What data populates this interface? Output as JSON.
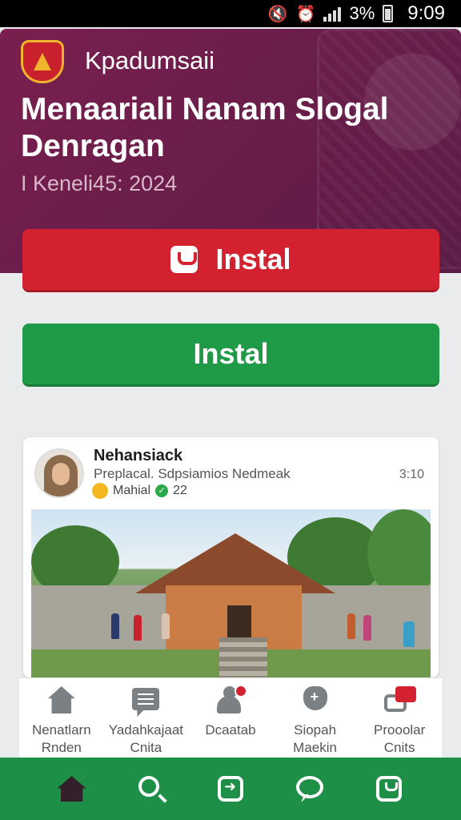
{
  "status_bar": {
    "battery": "3%",
    "time": "9:09"
  },
  "header": {
    "app_name": "Kpadumsaii",
    "title": "Menaariali Nanam Slogal Denragan",
    "date": "I Keneli45: 2024"
  },
  "buttons": {
    "primary_label": "Instal",
    "secondary_label": "Instal"
  },
  "post": {
    "author": "Nehansiack",
    "subtitle": "Preplacal. Sdpsiamios Nedmeak",
    "time": "3:10",
    "meta_label": "Mahial",
    "meta_count": "22"
  },
  "quick_actions": [
    {
      "icon": "home-icon",
      "label": "Nenatlarn Rnden"
    },
    {
      "icon": "chat-icon",
      "label": "Yadahkajaat Cnita"
    },
    {
      "icon": "user-icon",
      "label": "Dcaatab"
    },
    {
      "icon": "gear-add-icon",
      "label": "Siopah Maekin"
    },
    {
      "icon": "message-red-icon",
      "label": "Prooolar Cnits"
    }
  ],
  "bottom_nav": [
    {
      "icon": "home-icon"
    },
    {
      "icon": "search-icon"
    },
    {
      "icon": "share-icon"
    },
    {
      "icon": "chat-icon"
    },
    {
      "icon": "bag-icon"
    }
  ],
  "colors": {
    "hero": "#6b1e4a",
    "primary_button": "#d3212f",
    "secondary_button": "#1f9a47",
    "bottom_nav": "#1d8f47"
  }
}
